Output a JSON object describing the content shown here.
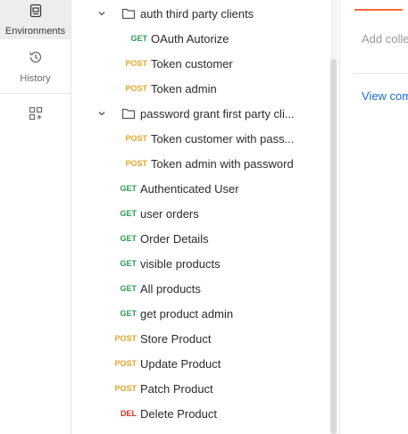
{
  "sidebar": {
    "environments_label": "Environments",
    "history_label": "History"
  },
  "tree": {
    "folders": [
      {
        "name": "auth third party clients"
      },
      {
        "name": "password grant first party cli..."
      }
    ],
    "requests": [
      {
        "method": "GET",
        "name": "OAuth Autorize"
      },
      {
        "method": "POST",
        "name": "Token customer"
      },
      {
        "method": "POST",
        "name": "Token admin"
      },
      {
        "method": "POST",
        "name": "Token customer with pass..."
      },
      {
        "method": "POST",
        "name": "Token admin with password"
      },
      {
        "method": "GET",
        "name": "Authenticated User"
      },
      {
        "method": "GET",
        "name": "user orders"
      },
      {
        "method": "GET",
        "name": "Order Details"
      },
      {
        "method": "GET",
        "name": "visible products"
      },
      {
        "method": "GET",
        "name": "All products"
      },
      {
        "method": "GET",
        "name": "get product admin"
      },
      {
        "method": "POST",
        "name": "Store Product"
      },
      {
        "method": "POST",
        "name": "Update Product"
      },
      {
        "method": "POST",
        "name": "Patch Product"
      },
      {
        "method": "DEL",
        "name": "Delete Product"
      }
    ]
  },
  "right_panel": {
    "add_description": "Add colle",
    "view_link": "View com"
  },
  "colors": {
    "get": "#2e9b4f",
    "post": "#e8a52a",
    "del": "#d0342c",
    "accent": "#ff6c37"
  }
}
